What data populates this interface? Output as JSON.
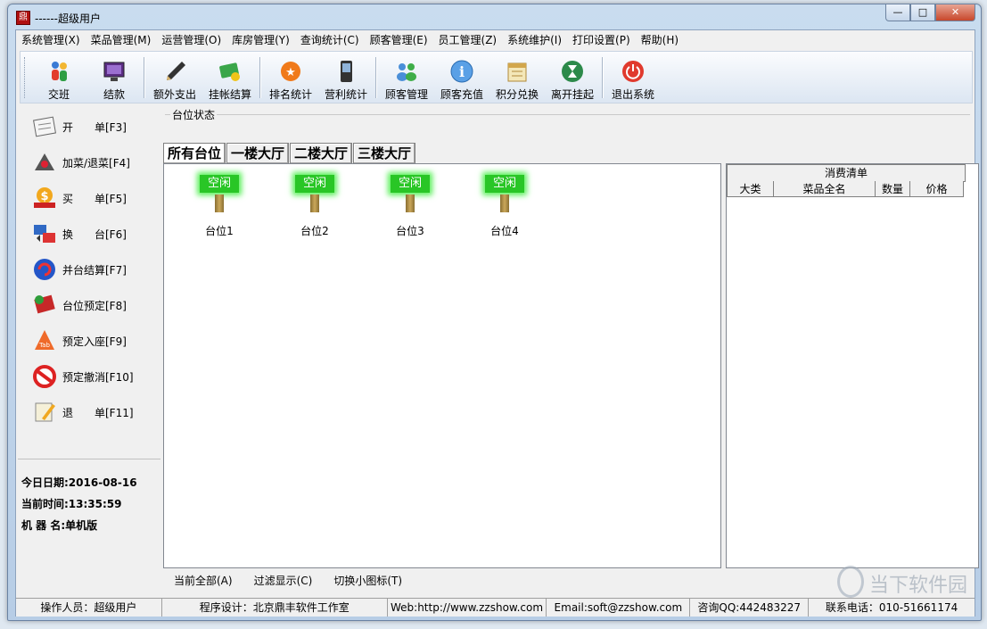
{
  "window": {
    "title": "------超级用户",
    "app_icon": "鼎"
  },
  "menu": [
    "系统管理(X)",
    "菜品管理(M)",
    "运营管理(O)",
    "库房管理(Y)",
    "查询统计(C)",
    "顾客管理(E)",
    "员工管理(Z)",
    "系统维护(I)",
    "打印设置(P)",
    "帮助(H)"
  ],
  "toolbar": [
    {
      "label": "交班",
      "icon": "people-icon"
    },
    {
      "label": "结款",
      "icon": "monitor-icon"
    },
    {
      "label": "额外支出",
      "icon": "pen-icon"
    },
    {
      "label": "挂帐结算",
      "icon": "card-icon"
    },
    {
      "label": "排名统计",
      "icon": "ranking-icon"
    },
    {
      "label": "营利统计",
      "icon": "pda-icon"
    },
    {
      "label": "顾客管理",
      "icon": "customers-icon"
    },
    {
      "label": "顾客充值",
      "icon": "info-icon"
    },
    {
      "label": "积分兑换",
      "icon": "calendar-icon"
    },
    {
      "label": "离开挂起",
      "icon": "hourglass-icon"
    },
    {
      "label": "退出系统",
      "icon": "power-icon"
    }
  ],
  "side_menu": [
    {
      "label": "开　　单[F3]",
      "icon": "paper-icon"
    },
    {
      "label": "加菜/退菜[F4]",
      "icon": "pyramid-icon"
    },
    {
      "label": "买　　单[F5]",
      "icon": "money-icon"
    },
    {
      "label": "换　　台[F6]",
      "icon": "swap-icon"
    },
    {
      "label": "并台结算[F7]",
      "icon": "refresh-icon"
    },
    {
      "label": "台位预定[F8]",
      "icon": "book-icon"
    },
    {
      "label": "预定入座[F9]",
      "icon": "seat-icon"
    },
    {
      "label": "预定撤消[F10]",
      "icon": "cancel-icon"
    },
    {
      "label": "退　　单[F11]",
      "icon": "pencil-icon"
    }
  ],
  "info": {
    "date": "今日日期:2016-08-16",
    "time": "当前时间:13:35:59",
    "machine": "机 器 名:单机版"
  },
  "main": {
    "group_label": "台位状态",
    "tabs": [
      "所有台位",
      "一楼大厅",
      "二楼大厅",
      "三楼大厅"
    ],
    "tables": [
      {
        "status": "空闲",
        "label": "台位1"
      },
      {
        "status": "空闲",
        "label": "台位2"
      },
      {
        "status": "空闲",
        "label": "台位3"
      },
      {
        "status": "空闲",
        "label": "台位4"
      }
    ],
    "bottom_buttons": [
      "当前全部(A)",
      "过滤显示(C)",
      "切换小图标(T)"
    ]
  },
  "bill": {
    "title": "消费清单",
    "columns": [
      "大类",
      "菜品全名",
      "数量",
      "价格"
    ]
  },
  "status": [
    "操作人员：超级用户",
    "程序设计：北京鼎丰软件工作室",
    "Web:http://www.zzshow.com",
    "Email:soft@zzshow.com",
    "咨询QQ:442483227",
    "联系电话：010-51661174"
  ],
  "watermark": "当下软件园",
  "colors": {
    "idle_sign": "#29c626",
    "window_frame": "#b7cde6"
  }
}
